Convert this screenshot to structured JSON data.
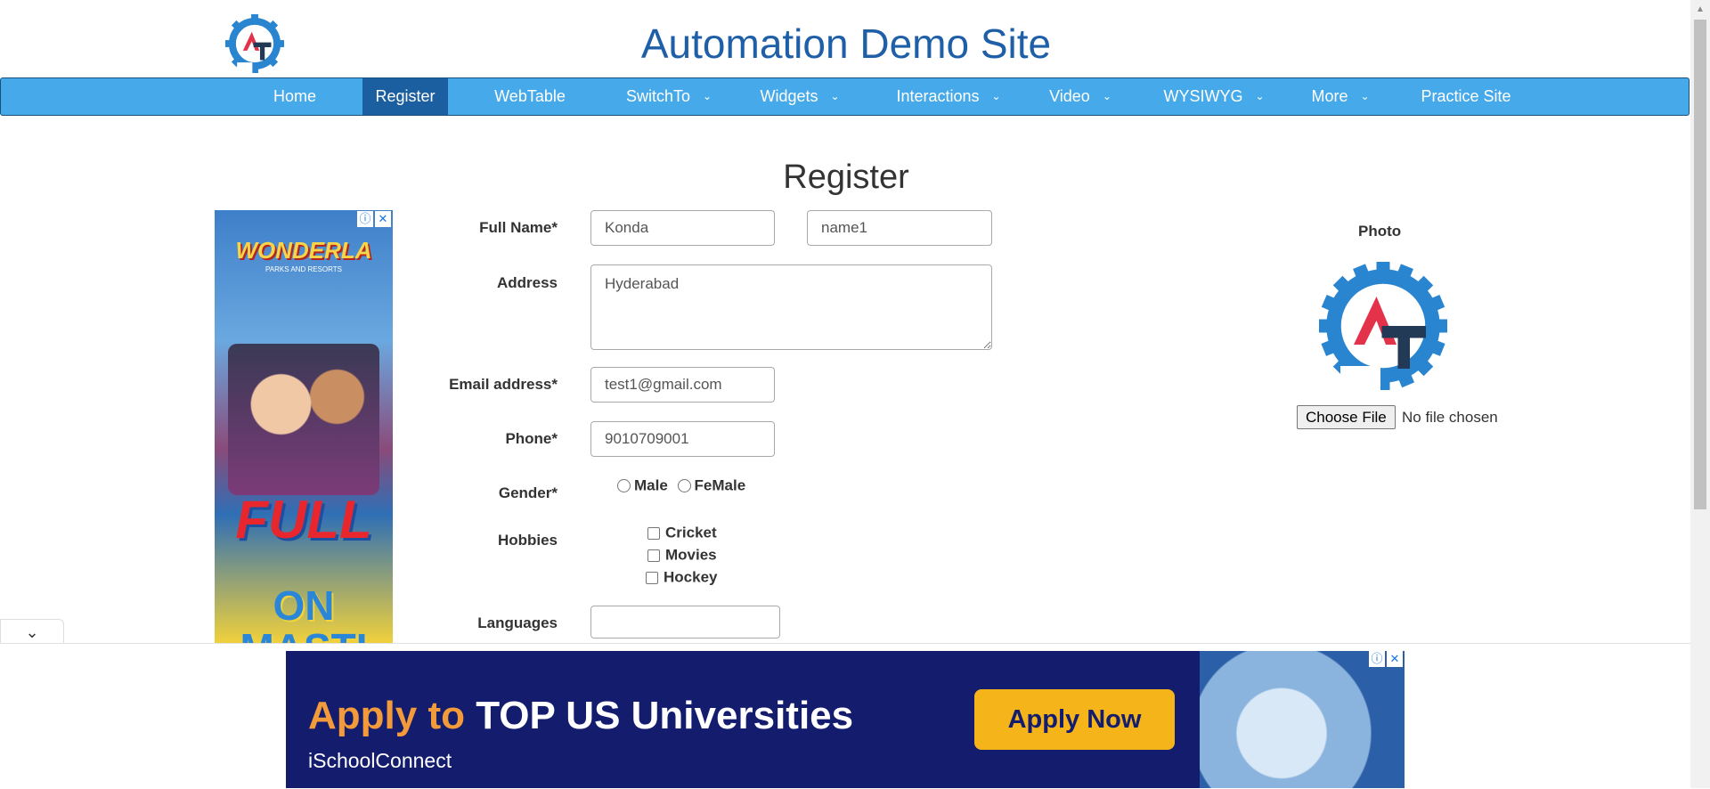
{
  "header": {
    "site_title": "Automation Demo Site",
    "logo_text": "AT"
  },
  "nav": [
    {
      "label": "Home",
      "active": false,
      "dropdown": false
    },
    {
      "label": "Register",
      "active": true,
      "dropdown": false
    },
    {
      "label": "WebTable",
      "active": false,
      "dropdown": false
    },
    {
      "label": "SwitchTo",
      "active": false,
      "dropdown": true
    },
    {
      "label": "Widgets",
      "active": false,
      "dropdown": true
    },
    {
      "label": "Interactions",
      "active": false,
      "dropdown": true
    },
    {
      "label": "Video",
      "active": false,
      "dropdown": true
    },
    {
      "label": "WYSIWYG",
      "active": false,
      "dropdown": true
    },
    {
      "label": "More",
      "active": false,
      "dropdown": true
    },
    {
      "label": "Practice Site",
      "active": false,
      "dropdown": false
    }
  ],
  "page": {
    "heading": "Register"
  },
  "form": {
    "full_name_label": "Full Name*",
    "first_name_value": "Konda",
    "last_name_value": "name1",
    "address_label": "Address",
    "address_value": "Hyderabad",
    "email_label": "Email address*",
    "email_value": "test1@gmail.com",
    "phone_label": "Phone*",
    "phone_value": "9010709001",
    "gender_label": "Gender*",
    "gender_options": [
      "Male",
      "FeMale"
    ],
    "hobbies_label": "Hobbies",
    "hobbies": [
      "Cricket",
      "Movies",
      "Hockey"
    ],
    "languages_label": "Languages",
    "languages_value": ""
  },
  "photo": {
    "label": "Photo",
    "choose_file_label": "Choose File",
    "file_status": "No file chosen"
  },
  "ads": {
    "left": {
      "brand": "WONDERLA",
      "sub": "PARKS AND RESORTS",
      "slogan_line1": "FULL",
      "slogan_line2": "ON MASTI"
    },
    "bottom": {
      "headline_part1": "Apply to",
      "headline_part2": "TOP US Universities",
      "cta": "Apply Now",
      "brand": "iSchoolConnect"
    },
    "info_icon": "ⓘ",
    "close_icon": "✕"
  },
  "colors": {
    "nav_bg": "#46a9ea",
    "nav_active": "#1c5fa0",
    "title": "#1e5fa8"
  }
}
